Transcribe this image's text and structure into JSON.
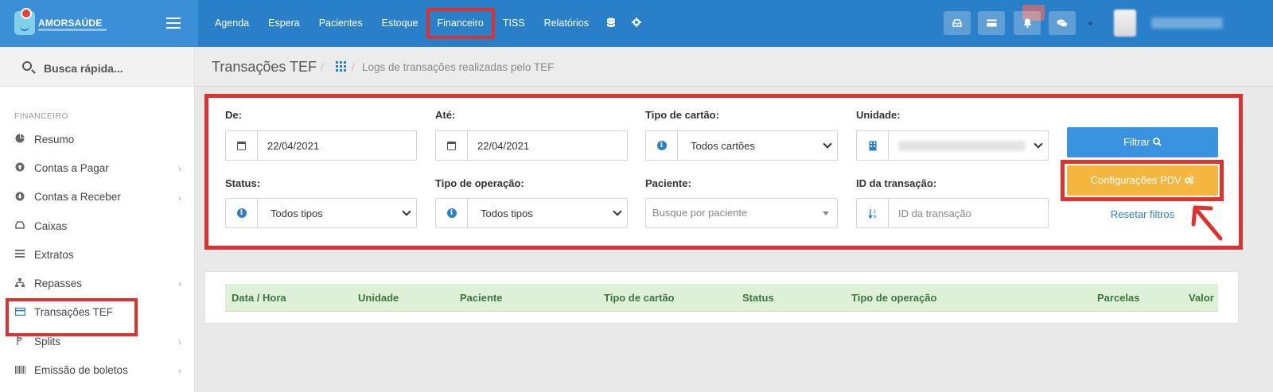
{
  "app": {
    "logo_text": "AMORSAÚDE"
  },
  "nav": {
    "items": [
      "Agenda",
      "Espera",
      "Pacientes",
      "Estoque",
      "Financeiro",
      "TISS",
      "Relatórios"
    ],
    "active": "Financeiro",
    "icons": [
      "database-icon",
      "gear-icon"
    ]
  },
  "topbar_buttons": [
    "inbox-icon",
    "card-icon",
    "bell-icon",
    "chat-icon"
  ],
  "sidebar": {
    "search_label": "Busca rápida...",
    "section": "FINANCEIRO",
    "items": [
      {
        "label": "Resumo",
        "icon": "pie-chart-icon",
        "chevron": false
      },
      {
        "label": "Contas a Pagar",
        "icon": "arrow-up-circle-icon",
        "chevron": true
      },
      {
        "label": "Contas a Receber",
        "icon": "arrow-down-circle-icon",
        "chevron": true
      },
      {
        "label": "Caixas",
        "icon": "inbox-icon",
        "chevron": false
      },
      {
        "label": "Extratos",
        "icon": "list-icon",
        "chevron": false
      },
      {
        "label": "Repasses",
        "icon": "sitemap-icon",
        "chevron": true
      },
      {
        "label": "Transações TEF",
        "icon": "credit-card-icon",
        "chevron": false,
        "active": true
      },
      {
        "label": "Splits",
        "icon": "split-icon",
        "chevron": true
      },
      {
        "label": "Emissão de boletos",
        "icon": "barcode-icon",
        "chevron": true
      }
    ]
  },
  "breadcrumb": {
    "title": "Transações TEF",
    "sub": "Logs de transações realizadas pelo TEF"
  },
  "filters": {
    "de": {
      "label": "De:",
      "value": "22/04/2021"
    },
    "ate": {
      "label": "Até:",
      "value": "22/04/2021"
    },
    "tipo_cartao": {
      "label": "Tipo de cartão:",
      "value": "Todos cartões"
    },
    "unidade": {
      "label": "Unidade:"
    },
    "status": {
      "label": "Status:",
      "value": "Todos tipos"
    },
    "tipo_operacao": {
      "label": "Tipo de operação:",
      "value": "Todos tipos"
    },
    "paciente": {
      "label": "Paciente:",
      "placeholder": "Busque por paciente"
    },
    "id_transacao": {
      "label": "ID da transação:",
      "placeholder": "ID da transação"
    }
  },
  "actions": {
    "filter": "Filtrar",
    "config_pdv": "Configurações PDV",
    "reset": "Resetar filtros"
  },
  "table": {
    "headers": [
      "Data / Hora",
      "Unidade",
      "Paciente",
      "Tipo de cartão",
      "Status",
      "Tipo de operação",
      "Parcelas",
      "Valor"
    ]
  },
  "colors": {
    "topbar": "#2a7fc9",
    "highlight": "#e03131",
    "filter_button": "#3a93de",
    "pdv_button": "#f4b63e",
    "table_header": "#dff0d8"
  }
}
